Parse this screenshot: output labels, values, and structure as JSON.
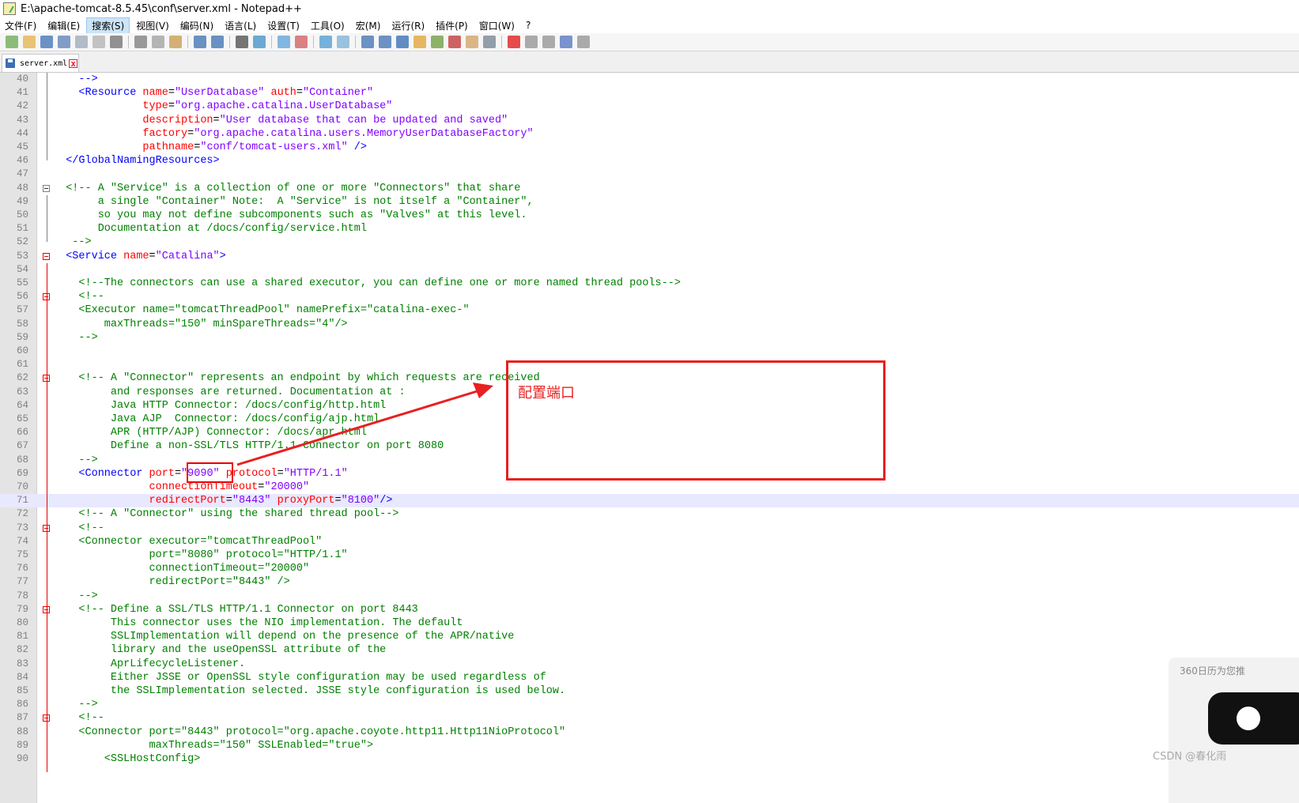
{
  "window": {
    "title": "E:\\apache-tomcat-8.5.45\\conf\\server.xml - Notepad++"
  },
  "menu": [
    {
      "label": "文件(F)"
    },
    {
      "label": "编辑(E)"
    },
    {
      "label": "搜索(S)"
    },
    {
      "label": "视图(V)"
    },
    {
      "label": "编码(N)"
    },
    {
      "label": "语言(L)"
    },
    {
      "label": "设置(T)"
    },
    {
      "label": "工具(O)"
    },
    {
      "label": "宏(M)"
    },
    {
      "label": "运行(R)"
    },
    {
      "label": "插件(P)"
    },
    {
      "label": "窗口(W)"
    },
    {
      "label": "?"
    }
  ],
  "active_menu": "搜索(S)",
  "toolbar_icons": [
    "new-file-icon",
    "open-file-icon",
    "save-icon",
    "save-all-icon",
    "close-icon",
    "close-all-icon",
    "print-icon",
    "cut-icon",
    "copy-icon",
    "paste-icon",
    "undo-icon",
    "redo-icon",
    "find-icon",
    "replace-icon",
    "zoom-in-icon",
    "zoom-out-icon",
    "sync-v-icon",
    "sync-h-icon",
    "word-wrap-icon",
    "show-all-chars-icon",
    "indent-guide-icon",
    "udl-icon",
    "doc-map-icon",
    "function-list-icon",
    "folder-workspace-icon",
    "monitor-icon",
    "record-macro-icon",
    "stop-macro-icon",
    "play-macro-icon",
    "run-macro-multiple-icon",
    "save-macro-icon"
  ],
  "tab": {
    "label": "server.xml",
    "close": "x"
  },
  "code_lines": [
    {
      "n": "40",
      "parts": [
        {
          "k": "p",
          "s": "    "
        },
        {
          "k": "t",
          "s": "-->"
        }
      ]
    },
    {
      "n": "41",
      "parts": [
        {
          "k": "p",
          "s": "    "
        },
        {
          "k": "t",
          "s": "<Resource "
        },
        {
          "k": "a",
          "s": "name"
        },
        {
          "k": "p",
          "s": "="
        },
        {
          "k": "v",
          "s": "\"UserDatabase\""
        },
        {
          "k": "p",
          "s": " "
        },
        {
          "k": "a",
          "s": "auth"
        },
        {
          "k": "p",
          "s": "="
        },
        {
          "k": "v",
          "s": "\"Container\""
        }
      ]
    },
    {
      "n": "42",
      "parts": [
        {
          "k": "p",
          "s": "              "
        },
        {
          "k": "a",
          "s": "type"
        },
        {
          "k": "p",
          "s": "="
        },
        {
          "k": "v",
          "s": "\"org.apache.catalina.UserDatabase\""
        }
      ]
    },
    {
      "n": "43",
      "parts": [
        {
          "k": "p",
          "s": "              "
        },
        {
          "k": "a",
          "s": "description"
        },
        {
          "k": "p",
          "s": "="
        },
        {
          "k": "v",
          "s": "\"User database that can be updated and saved\""
        }
      ]
    },
    {
      "n": "44",
      "parts": [
        {
          "k": "p",
          "s": "              "
        },
        {
          "k": "a",
          "s": "factory"
        },
        {
          "k": "p",
          "s": "="
        },
        {
          "k": "v",
          "s": "\"org.apache.catalina.users.MemoryUserDatabaseFactory\""
        }
      ]
    },
    {
      "n": "45",
      "parts": [
        {
          "k": "p",
          "s": "              "
        },
        {
          "k": "a",
          "s": "pathname"
        },
        {
          "k": "p",
          "s": "="
        },
        {
          "k": "v",
          "s": "\"conf/tomcat-users.xml\""
        },
        {
          "k": "t",
          "s": " />"
        }
      ]
    },
    {
      "n": "46",
      "parts": [
        {
          "k": "p",
          "s": "  "
        },
        {
          "k": "t",
          "s": "</GlobalNamingResources>"
        }
      ]
    },
    {
      "n": "47",
      "parts": []
    },
    {
      "n": "48",
      "parts": [
        {
          "k": "p",
          "s": "  "
        },
        {
          "k": "c",
          "s": "<!-- A \"Service\" is a collection of one or more \"Connectors\" that share"
        }
      ]
    },
    {
      "n": "49",
      "parts": [
        {
          "k": "c",
          "s": "       a single \"Container\" Note:  A \"Service\" is not itself a \"Container\","
        }
      ]
    },
    {
      "n": "50",
      "parts": [
        {
          "k": "c",
          "s": "       so you may not define subcomponents such as \"Valves\" at this level."
        }
      ]
    },
    {
      "n": "51",
      "parts": [
        {
          "k": "c",
          "s": "       Documentation at /docs/config/service.html"
        }
      ]
    },
    {
      "n": "52",
      "parts": [
        {
          "k": "c",
          "s": "   -->"
        }
      ]
    },
    {
      "n": "53",
      "parts": [
        {
          "k": "p",
          "s": "  "
        },
        {
          "k": "t",
          "s": "<Service "
        },
        {
          "k": "a",
          "s": "name"
        },
        {
          "k": "p",
          "s": "="
        },
        {
          "k": "v",
          "s": "\"Catalina\""
        },
        {
          "k": "t",
          "s": ">"
        }
      ]
    },
    {
      "n": "54",
      "parts": []
    },
    {
      "n": "55",
      "parts": [
        {
          "k": "p",
          "s": "    "
        },
        {
          "k": "c",
          "s": "<!--The connectors can use a shared executor, you can define one or more named thread pools-->"
        }
      ]
    },
    {
      "n": "56",
      "parts": [
        {
          "k": "p",
          "s": "    "
        },
        {
          "k": "c",
          "s": "<!--"
        }
      ]
    },
    {
      "n": "57",
      "parts": [
        {
          "k": "c",
          "s": "    <Executor name=\"tomcatThreadPool\" namePrefix=\"catalina-exec-\""
        }
      ]
    },
    {
      "n": "58",
      "parts": [
        {
          "k": "c",
          "s": "        maxThreads=\"150\" minSpareThreads=\"4\"/>"
        }
      ]
    },
    {
      "n": "59",
      "parts": [
        {
          "k": "c",
          "s": "    -->"
        }
      ]
    },
    {
      "n": "60",
      "parts": []
    },
    {
      "n": "61",
      "parts": []
    },
    {
      "n": "62",
      "parts": [
        {
          "k": "p",
          "s": "    "
        },
        {
          "k": "c",
          "s": "<!-- A \"Connector\" represents an endpoint by which requests are received"
        }
      ]
    },
    {
      "n": "63",
      "parts": [
        {
          "k": "c",
          "s": "         and responses are returned. Documentation at :"
        }
      ]
    },
    {
      "n": "64",
      "parts": [
        {
          "k": "c",
          "s": "         Java HTTP Connector: /docs/config/http.html"
        }
      ]
    },
    {
      "n": "65",
      "parts": [
        {
          "k": "c",
          "s": "         Java AJP  Connector: /docs/config/ajp.html"
        }
      ]
    },
    {
      "n": "66",
      "parts": [
        {
          "k": "c",
          "s": "         APR (HTTP/AJP) Connector: /docs/apr.html"
        }
      ]
    },
    {
      "n": "67",
      "parts": [
        {
          "k": "c",
          "s": "         Define a non-SSL/TLS HTTP/1.1 Connector on port 8080"
        }
      ]
    },
    {
      "n": "68",
      "parts": [
        {
          "k": "c",
          "s": "    -->"
        }
      ]
    },
    {
      "n": "69",
      "parts": [
        {
          "k": "p",
          "s": "    "
        },
        {
          "k": "t",
          "s": "<Connector "
        },
        {
          "k": "a",
          "s": "port"
        },
        {
          "k": "p",
          "s": "="
        },
        {
          "k": "v",
          "s": "\"9090\""
        },
        {
          "k": "p",
          "s": " "
        },
        {
          "k": "a",
          "s": "protocol"
        },
        {
          "k": "p",
          "s": "="
        },
        {
          "k": "v",
          "s": "\"HTTP/1.1\""
        }
      ]
    },
    {
      "n": "70",
      "parts": [
        {
          "k": "p",
          "s": "               "
        },
        {
          "k": "a",
          "s": "connectionTimeout"
        },
        {
          "k": "p",
          "s": "="
        },
        {
          "k": "v",
          "s": "\"20000\""
        }
      ]
    },
    {
      "n": "71",
      "parts": [
        {
          "k": "p",
          "s": "               "
        },
        {
          "k": "a",
          "s": "redirectPort"
        },
        {
          "k": "p",
          "s": "="
        },
        {
          "k": "v",
          "s": "\"8443\""
        },
        {
          "k": "p",
          "s": " "
        },
        {
          "k": "a",
          "s": "proxyPort"
        },
        {
          "k": "p",
          "s": "="
        },
        {
          "k": "v",
          "s": "\"8100\""
        },
        {
          "k": "t",
          "s": "/>"
        }
      ]
    },
    {
      "n": "72",
      "parts": [
        {
          "k": "p",
          "s": "    "
        },
        {
          "k": "c",
          "s": "<!-- A \"Connector\" using the shared thread pool-->"
        }
      ]
    },
    {
      "n": "73",
      "parts": [
        {
          "k": "p",
          "s": "    "
        },
        {
          "k": "c",
          "s": "<!--"
        }
      ]
    },
    {
      "n": "74",
      "parts": [
        {
          "k": "c",
          "s": "    <Connector executor=\"tomcatThreadPool\""
        }
      ]
    },
    {
      "n": "75",
      "parts": [
        {
          "k": "c",
          "s": "               port=\"8080\" protocol=\"HTTP/1.1\""
        }
      ]
    },
    {
      "n": "76",
      "parts": [
        {
          "k": "c",
          "s": "               connectionTimeout=\"20000\""
        }
      ]
    },
    {
      "n": "77",
      "parts": [
        {
          "k": "c",
          "s": "               redirectPort=\"8443\" />"
        }
      ]
    },
    {
      "n": "78",
      "parts": [
        {
          "k": "c",
          "s": "    -->"
        }
      ]
    },
    {
      "n": "79",
      "parts": [
        {
          "k": "p",
          "s": "    "
        },
        {
          "k": "c",
          "s": "<!-- Define a SSL/TLS HTTP/1.1 Connector on port 8443"
        }
      ]
    },
    {
      "n": "80",
      "parts": [
        {
          "k": "c",
          "s": "         This connector uses the NIO implementation. The default"
        }
      ]
    },
    {
      "n": "81",
      "parts": [
        {
          "k": "c",
          "s": "         SSLImplementation will depend on the presence of the APR/native"
        }
      ]
    },
    {
      "n": "82",
      "parts": [
        {
          "k": "c",
          "s": "         library and the useOpenSSL attribute of the"
        }
      ]
    },
    {
      "n": "83",
      "parts": [
        {
          "k": "c",
          "s": "         AprLifecycleListener."
        }
      ]
    },
    {
      "n": "84",
      "parts": [
        {
          "k": "c",
          "s": "         Either JSSE or OpenSSL style configuration may be used regardless of"
        }
      ]
    },
    {
      "n": "85",
      "parts": [
        {
          "k": "c",
          "s": "         the SSLImplementation selected. JSSE style configuration is used below."
        }
      ]
    },
    {
      "n": "86",
      "parts": [
        {
          "k": "c",
          "s": "    -->"
        }
      ]
    },
    {
      "n": "87",
      "parts": [
        {
          "k": "p",
          "s": "    "
        },
        {
          "k": "c",
          "s": "<!--"
        }
      ]
    },
    {
      "n": "88",
      "parts": [
        {
          "k": "c",
          "s": "    <Connector port=\"8443\" protocol=\"org.apache.coyote.http11.Http11NioProtocol\""
        }
      ]
    },
    {
      "n": "89",
      "parts": [
        {
          "k": "c",
          "s": "               maxThreads=\"150\" SSLEnabled=\"true\">"
        }
      ]
    },
    {
      "n": "90",
      "parts": [
        {
          "k": "c",
          "s": "        <SSLHostConfig>"
        }
      ]
    }
  ],
  "current_line": "71",
  "fold_markers": [
    "48",
    "53",
    "56",
    "62",
    "73",
    "79",
    "87"
  ],
  "annotation": {
    "label": "配置端口",
    "color": "#e82020"
  },
  "popup": {
    "text": "360日历为您推"
  },
  "watermark": "CSDN @春化雨"
}
